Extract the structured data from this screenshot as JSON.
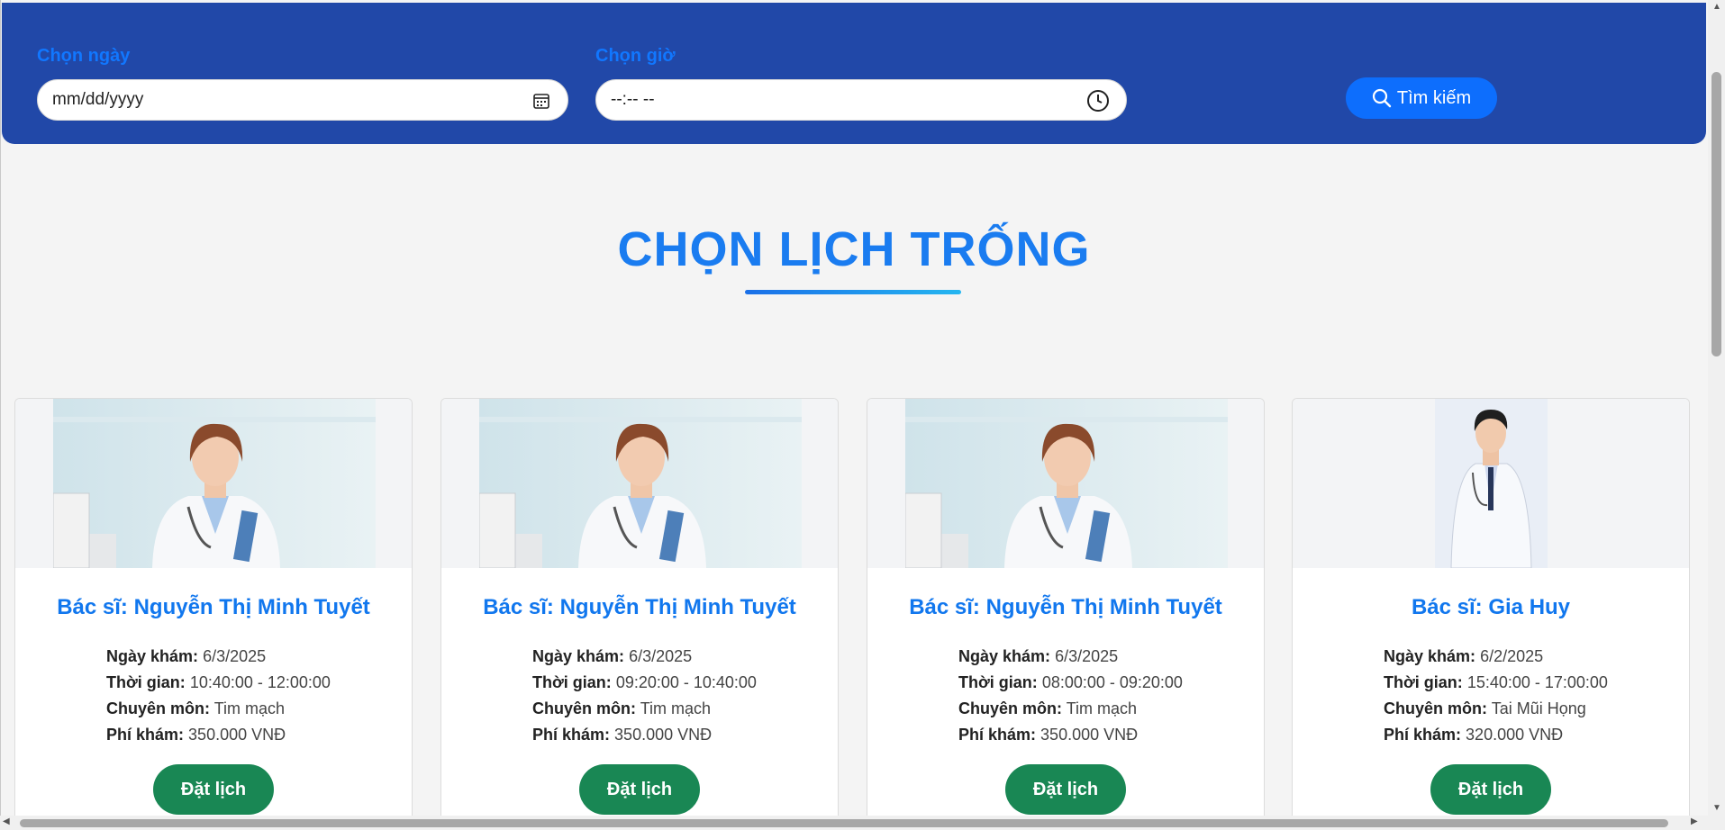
{
  "search": {
    "date_label": "Chọn ngày",
    "date_placeholder": "mm/dd/yyyy",
    "time_label": "Chọn giờ",
    "time_placeholder": "--:-- --",
    "button_label": "Tìm kiếm"
  },
  "page_title": "CHỌN LỊCH TRỐNG",
  "labels": {
    "date": "Ngày khám:",
    "time": "Thời gian:",
    "specialty": "Chuyên môn:",
    "fee": "Phí khám:",
    "book": "Đặt lịch"
  },
  "cards": [
    {
      "name": "Bác sĩ: Nguyễn Thị Minh Tuyết",
      "date": "6/3/2025",
      "time": "10:40:00 - 12:00:00",
      "specialty": "Tim mạch",
      "fee": "350.000 VNĐ",
      "photo": "female-doctor-photo"
    },
    {
      "name": "Bác sĩ: Nguyễn Thị Minh Tuyết",
      "date": "6/3/2025",
      "time": "09:20:00 - 10:40:00",
      "specialty": "Tim mạch",
      "fee": "350.000 VNĐ",
      "photo": "female-doctor-photo"
    },
    {
      "name": "Bác sĩ: Nguyễn Thị Minh Tuyết",
      "date": "6/3/2025",
      "time": "08:00:00 - 09:20:00",
      "specialty": "Tim mạch",
      "fee": "350.000 VNĐ",
      "photo": "female-doctor-photo"
    },
    {
      "name": "Bác sĩ: Gia Huy",
      "date": "6/2/2025",
      "time": "15:40:00 - 17:00:00",
      "specialty": "Tai Mũi Họng",
      "fee": "320.000 VNĐ",
      "photo": "male-doctor-photo"
    }
  ],
  "colors": {
    "header_bg": "#2148a8",
    "accent": "#1177ee",
    "search_button": "#0d6efd",
    "book_button": "#198754"
  }
}
